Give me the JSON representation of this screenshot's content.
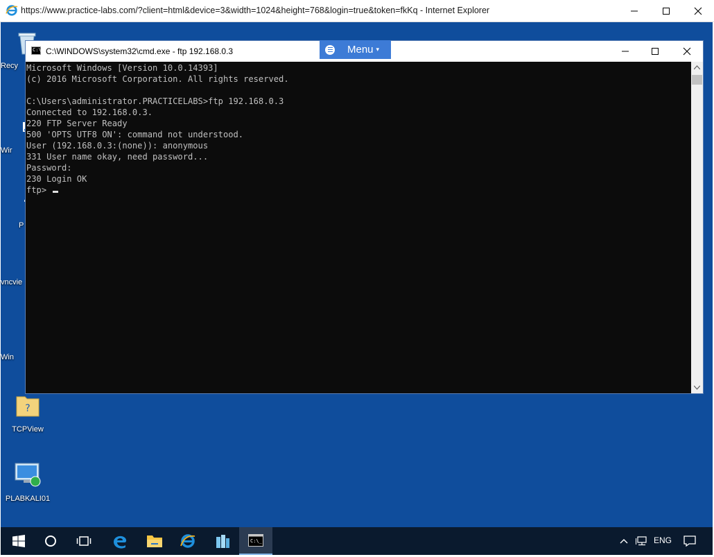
{
  "browser": {
    "title": "https://www.practice-labs.com/?client=html&device=3&width=1024&height=768&login=true&token=fkKq - Internet Explorer"
  },
  "desktop": {
    "icons": [
      {
        "label": "Recy",
        "icon": "recycle-bin-icon"
      },
      {
        "label": "Wir",
        "icon": "shortcut-icon"
      },
      {
        "label": "P",
        "icon": "computer-icon"
      },
      {
        "label": "vncvie",
        "icon": "vncviewer-icon"
      },
      {
        "label": "Win",
        "icon": "window-icon"
      },
      {
        "label": "TCPView",
        "icon": "tcpview-icon"
      },
      {
        "label": "PLABKALI01",
        "icon": "remote-desktop-icon"
      }
    ],
    "background_color": "#0f4d9c"
  },
  "menu": {
    "label": "Menu",
    "caret": "▾"
  },
  "cmd": {
    "title": "C:\\WINDOWS\\system32\\cmd.exe - ftp  192.168.0.3",
    "icon_text": "C:\\",
    "lines": [
      "Microsoft Windows [Version 10.0.14393]",
      "(c) 2016 Microsoft Corporation. All rights reserved.",
      "",
      "C:\\Users\\administrator.PRACTICELABS>ftp 192.168.0.3",
      "Connected to 192.168.0.3.",
      "220 FTP Server Ready",
      "500 'OPTS UTF8 ON': command not understood.",
      "User (192.168.0.3:(none)): anonymous",
      "331 User name okay, need password...",
      "Password:",
      "230 Login OK"
    ],
    "prompt": "ftp> "
  },
  "taskbar": {
    "items": [
      "start-icon",
      "cortana-icon",
      "task-view-icon",
      "edge-icon",
      "file-explorer-icon",
      "internet-explorer-icon",
      "server-manager-icon",
      "cmd-icon"
    ],
    "language": "ENG",
    "tray": [
      "chevron-up-icon",
      "network-icon",
      "volume-icon",
      "notification-icon"
    ]
  }
}
